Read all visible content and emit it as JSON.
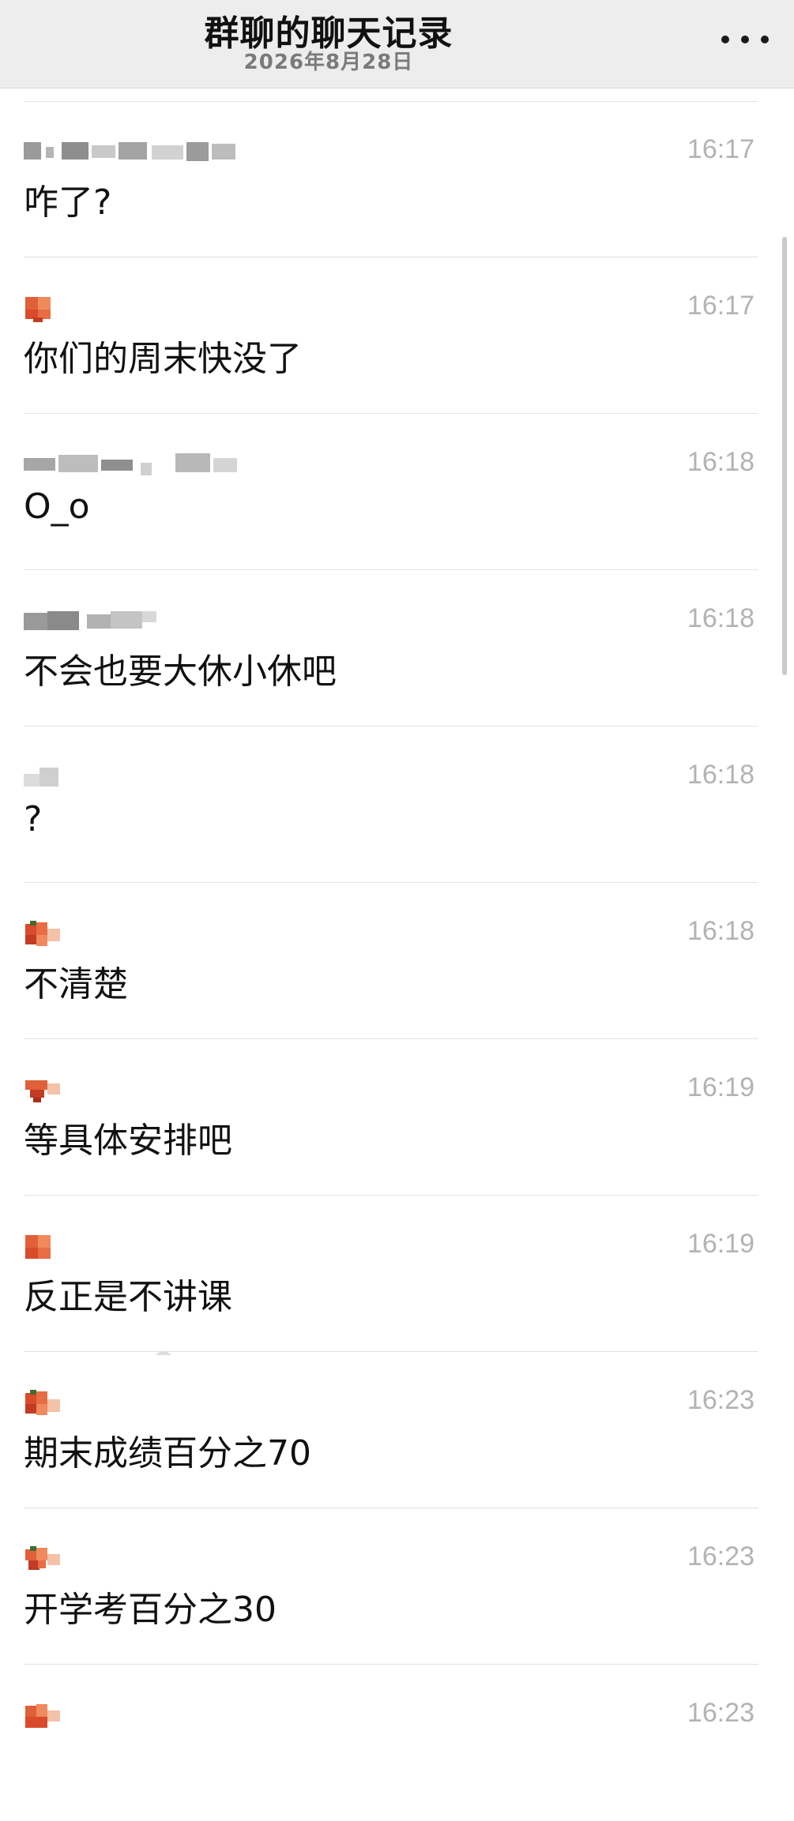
{
  "header": {
    "title": "群聊的聊天记录",
    "date": "2026年8月28日",
    "more_icon": "more-horizontal-icon"
  },
  "messages": [
    {
      "text": "咋了?",
      "time": "16:17",
      "sender_style": "pixelated-gray"
    },
    {
      "text": "你们的周末快没了",
      "time": "16:17",
      "sender_style": "pixel-avatar-orange"
    },
    {
      "text": "O_o",
      "time": "16:18",
      "sender_style": "pixelated-gray"
    },
    {
      "text": "不会也要大休小休吧",
      "time": "16:18",
      "sender_style": "pixelated-gray"
    },
    {
      "text": "?",
      "time": "16:18",
      "sender_style": "pixelated-light"
    },
    {
      "text": "不清楚",
      "time": "16:18",
      "sender_style": "pixel-avatar-orange"
    },
    {
      "text": "等具体安排吧",
      "time": "16:19",
      "sender_style": "pixel-avatar-orange"
    },
    {
      "text": "反正是不讲课",
      "time": "16:19",
      "sender_style": "pixel-avatar-orange"
    },
    {
      "text": "期末成绩百分之70",
      "time": "16:23",
      "sender_style": "pixel-avatar-orange"
    },
    {
      "text": "开学考百分之30",
      "time": "16:23",
      "sender_style": "pixel-avatar-orange"
    },
    {
      "text": "",
      "time": "16:23",
      "sender_style": "pixel-avatar-orange"
    }
  ],
  "colors": {
    "header_bg": "#ededed",
    "time_text": "#b3b3b3",
    "message_text": "#111111",
    "divider": "#e2e2e2",
    "avatar_orange": "#e0603a"
  }
}
